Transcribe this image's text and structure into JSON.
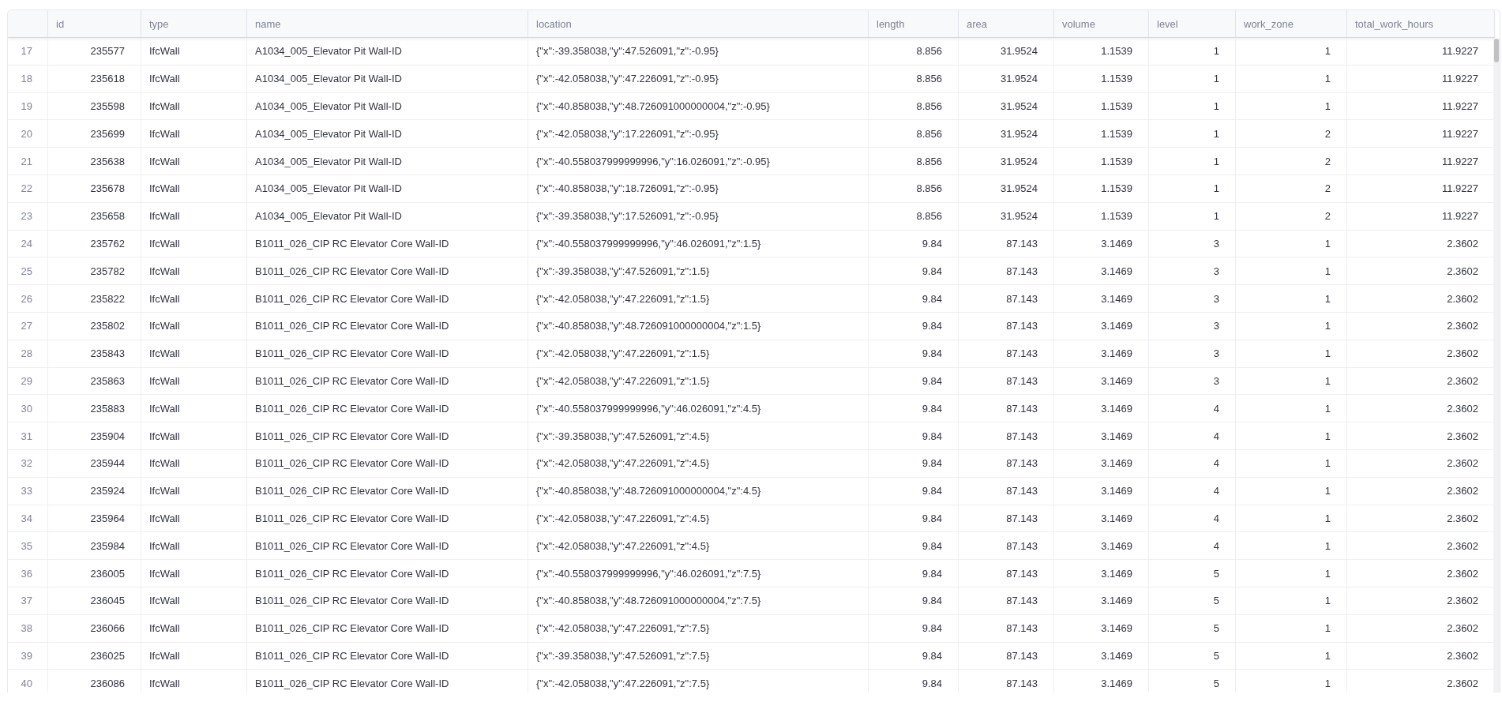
{
  "table": {
    "columns": [
      {
        "label": "id",
        "kind": "number"
      },
      {
        "label": "type",
        "kind": "text"
      },
      {
        "label": "name",
        "kind": "text"
      },
      {
        "label": "location",
        "kind": "text"
      },
      {
        "label": "length",
        "kind": "number"
      },
      {
        "label": "area",
        "kind": "number"
      },
      {
        "label": "volume",
        "kind": "number"
      },
      {
        "label": "level",
        "kind": "number"
      },
      {
        "label": "work_zone",
        "kind": "number"
      },
      {
        "label": "total_work_hours",
        "kind": "number"
      }
    ],
    "rows": [
      {
        "index": "17",
        "cells": [
          "235577",
          "IfcWall",
          "A1034_005_Elevator Pit Wall-ID",
          "{\"x\":-39.358038,\"y\":47.526091,\"z\":-0.95}",
          "8.856",
          "31.9524",
          "1.1539",
          "1",
          "1",
          "11.9227"
        ]
      },
      {
        "index": "18",
        "cells": [
          "235618",
          "IfcWall",
          "A1034_005_Elevator Pit Wall-ID",
          "{\"x\":-42.058038,\"y\":47.226091,\"z\":-0.95}",
          "8.856",
          "31.9524",
          "1.1539",
          "1",
          "1",
          "11.9227"
        ]
      },
      {
        "index": "19",
        "cells": [
          "235598",
          "IfcWall",
          "A1034_005_Elevator Pit Wall-ID",
          "{\"x\":-40.858038,\"y\":48.726091000000004,\"z\":-0.95}",
          "8.856",
          "31.9524",
          "1.1539",
          "1",
          "1",
          "11.9227"
        ]
      },
      {
        "index": "20",
        "cells": [
          "235699",
          "IfcWall",
          "A1034_005_Elevator Pit Wall-ID",
          "{\"x\":-42.058038,\"y\":17.226091,\"z\":-0.95}",
          "8.856",
          "31.9524",
          "1.1539",
          "1",
          "2",
          "11.9227"
        ]
      },
      {
        "index": "21",
        "cells": [
          "235638",
          "IfcWall",
          "A1034_005_Elevator Pit Wall-ID",
          "{\"x\":-40.558037999999996,\"y\":16.026091,\"z\":-0.95}",
          "8.856",
          "31.9524",
          "1.1539",
          "1",
          "2",
          "11.9227"
        ]
      },
      {
        "index": "22",
        "cells": [
          "235678",
          "IfcWall",
          "A1034_005_Elevator Pit Wall-ID",
          "{\"x\":-40.858038,\"y\":18.726091,\"z\":-0.95}",
          "8.856",
          "31.9524",
          "1.1539",
          "1",
          "2",
          "11.9227"
        ]
      },
      {
        "index": "23",
        "cells": [
          "235658",
          "IfcWall",
          "A1034_005_Elevator Pit Wall-ID",
          "{\"x\":-39.358038,\"y\":17.526091,\"z\":-0.95}",
          "8.856",
          "31.9524",
          "1.1539",
          "1",
          "2",
          "11.9227"
        ]
      },
      {
        "index": "24",
        "cells": [
          "235762",
          "IfcWall",
          "B1011_026_CIP RC Elevator Core Wall-ID",
          "{\"x\":-40.558037999999996,\"y\":46.026091,\"z\":1.5}",
          "9.84",
          "87.143",
          "3.1469",
          "3",
          "1",
          "2.3602"
        ]
      },
      {
        "index": "25",
        "cells": [
          "235782",
          "IfcWall",
          "B1011_026_CIP RC Elevator Core Wall-ID",
          "{\"x\":-39.358038,\"y\":47.526091,\"z\":1.5}",
          "9.84",
          "87.143",
          "3.1469",
          "3",
          "1",
          "2.3602"
        ]
      },
      {
        "index": "26",
        "cells": [
          "235822",
          "IfcWall",
          "B1011_026_CIP RC Elevator Core Wall-ID",
          "{\"x\":-42.058038,\"y\":47.226091,\"z\":1.5}",
          "9.84",
          "87.143",
          "3.1469",
          "3",
          "1",
          "2.3602"
        ]
      },
      {
        "index": "27",
        "cells": [
          "235802",
          "IfcWall",
          "B1011_026_CIP RC Elevator Core Wall-ID",
          "{\"x\":-40.858038,\"y\":48.726091000000004,\"z\":1.5}",
          "9.84",
          "87.143",
          "3.1469",
          "3",
          "1",
          "2.3602"
        ]
      },
      {
        "index": "28",
        "cells": [
          "235843",
          "IfcWall",
          "B1011_026_CIP RC Elevator Core Wall-ID",
          "{\"x\":-42.058038,\"y\":47.226091,\"z\":1.5}",
          "9.84",
          "87.143",
          "3.1469",
          "3",
          "1",
          "2.3602"
        ]
      },
      {
        "index": "29",
        "cells": [
          "235863",
          "IfcWall",
          "B1011_026_CIP RC Elevator Core Wall-ID",
          "{\"x\":-42.058038,\"y\":47.226091,\"z\":1.5}",
          "9.84",
          "87.143",
          "3.1469",
          "3",
          "1",
          "2.3602"
        ]
      },
      {
        "index": "30",
        "cells": [
          "235883",
          "IfcWall",
          "B1011_026_CIP RC Elevator Core Wall-ID",
          "{\"x\":-40.558037999999996,\"y\":46.026091,\"z\":4.5}",
          "9.84",
          "87.143",
          "3.1469",
          "4",
          "1",
          "2.3602"
        ]
      },
      {
        "index": "31",
        "cells": [
          "235904",
          "IfcWall",
          "B1011_026_CIP RC Elevator Core Wall-ID",
          "{\"x\":-39.358038,\"y\":47.526091,\"z\":4.5}",
          "9.84",
          "87.143",
          "3.1469",
          "4",
          "1",
          "2.3602"
        ]
      },
      {
        "index": "32",
        "cells": [
          "235944",
          "IfcWall",
          "B1011_026_CIP RC Elevator Core Wall-ID",
          "{\"x\":-42.058038,\"y\":47.226091,\"z\":4.5}",
          "9.84",
          "87.143",
          "3.1469",
          "4",
          "1",
          "2.3602"
        ]
      },
      {
        "index": "33",
        "cells": [
          "235924",
          "IfcWall",
          "B1011_026_CIP RC Elevator Core Wall-ID",
          "{\"x\":-40.858038,\"y\":48.726091000000004,\"z\":4.5}",
          "9.84",
          "87.143",
          "3.1469",
          "4",
          "1",
          "2.3602"
        ]
      },
      {
        "index": "34",
        "cells": [
          "235964",
          "IfcWall",
          "B1011_026_CIP RC Elevator Core Wall-ID",
          "{\"x\":-42.058038,\"y\":47.226091,\"z\":4.5}",
          "9.84",
          "87.143",
          "3.1469",
          "4",
          "1",
          "2.3602"
        ]
      },
      {
        "index": "35",
        "cells": [
          "235984",
          "IfcWall",
          "B1011_026_CIP RC Elevator Core Wall-ID",
          "{\"x\":-42.058038,\"y\":47.226091,\"z\":4.5}",
          "9.84",
          "87.143",
          "3.1469",
          "4",
          "1",
          "2.3602"
        ]
      },
      {
        "index": "36",
        "cells": [
          "236005",
          "IfcWall",
          "B1011_026_CIP RC Elevator Core Wall-ID",
          "{\"x\":-40.558037999999996,\"y\":46.026091,\"z\":7.5}",
          "9.84",
          "87.143",
          "3.1469",
          "5",
          "1",
          "2.3602"
        ]
      },
      {
        "index": "37",
        "cells": [
          "236045",
          "IfcWall",
          "B1011_026_CIP RC Elevator Core Wall-ID",
          "{\"x\":-40.858038,\"y\":48.726091000000004,\"z\":7.5}",
          "9.84",
          "87.143",
          "3.1469",
          "5",
          "1",
          "2.3602"
        ]
      },
      {
        "index": "38",
        "cells": [
          "236066",
          "IfcWall",
          "B1011_026_CIP RC Elevator Core Wall-ID",
          "{\"x\":-42.058038,\"y\":47.226091,\"z\":7.5}",
          "9.84",
          "87.143",
          "3.1469",
          "5",
          "1",
          "2.3602"
        ]
      },
      {
        "index": "39",
        "cells": [
          "236025",
          "IfcWall",
          "B1011_026_CIP RC Elevator Core Wall-ID",
          "{\"x\":-39.358038,\"y\":47.526091,\"z\":7.5}",
          "9.84",
          "87.143",
          "3.1469",
          "5",
          "1",
          "2.3602"
        ]
      },
      {
        "index": "40",
        "cells": [
          "236086",
          "IfcWall",
          "B1011_026_CIP RC Elevator Core Wall-ID",
          "{\"x\":-42.058038,\"y\":47.226091,\"z\":7.5}",
          "9.84",
          "87.143",
          "3.1469",
          "5",
          "1",
          "2.3602"
        ]
      }
    ]
  }
}
